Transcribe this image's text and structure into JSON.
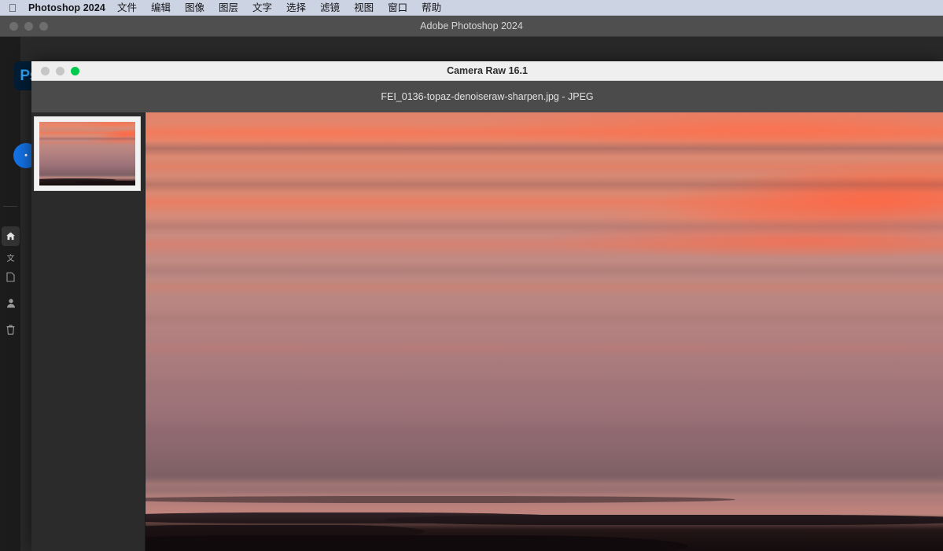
{
  "menubar": {
    "apple_glyph": "",
    "app_name": "Photoshop 2024",
    "items": [
      {
        "label": "文件"
      },
      {
        "label": "编辑"
      },
      {
        "label": "图像"
      },
      {
        "label": "图层"
      },
      {
        "label": "文字"
      },
      {
        "label": "选择"
      },
      {
        "label": "滤镜"
      },
      {
        "label": "视图"
      },
      {
        "label": "窗口"
      },
      {
        "label": "帮助"
      }
    ]
  },
  "photoshop_window": {
    "title": "Adobe Photoshop 2024",
    "logo_text": "Ps",
    "avatar_initials": "•",
    "traffic_lights": [
      "close",
      "minimize",
      "zoom"
    ],
    "rail_items": [
      {
        "name": "home",
        "label": ""
      },
      {
        "name": "text",
        "label": "文"
      },
      {
        "name": "files",
        "label": ""
      },
      {
        "name": "user",
        "label": ""
      },
      {
        "name": "trash",
        "label": ""
      }
    ]
  },
  "camera_raw_window": {
    "title": "Camera Raw 16.1",
    "filename": "FEI_0136-topaz-denoiseraw-sharpen.jpg -  JPEG",
    "traffic_lights": [
      "close",
      "minimize",
      "zoom"
    ],
    "filmstrip": {
      "selected_index": 0,
      "thumbnails": [
        {
          "name": "FEI_0136-topaz-denoiseraw-sharpen.jpg",
          "selected": true
        }
      ]
    },
    "preview": {
      "subject": "sunset seascape with coral sky, mudflats and reflective water"
    }
  },
  "colors": {
    "menubar_bg": "#ccd3e2",
    "ps_titlebar_bg": "#4f4f4f",
    "ps_body_bg": "#292929",
    "ps_logo_bg": "#001e36",
    "ps_logo_fg": "#31a8ff",
    "avatar_bg": "#1473e6",
    "cr_titlebar_bg": "#efefef",
    "cr_filebar_bg": "#4b4b4b",
    "cr_panel_bg": "#2b2b2b",
    "zoom_light": "#00ca4e",
    "inactive_light": "#c6c6c6"
  }
}
